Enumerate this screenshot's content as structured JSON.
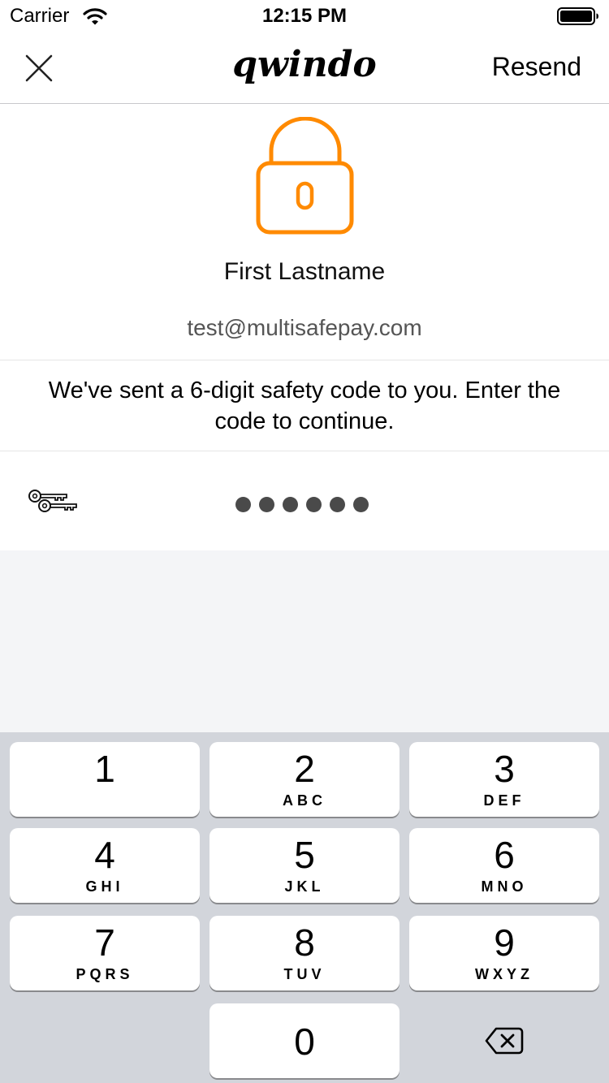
{
  "status_bar": {
    "carrier": "Carrier",
    "time": "12:15 PM"
  },
  "nav": {
    "logo": "qwindo",
    "resend_label": "Resend",
    "close_icon": "close-icon"
  },
  "profile": {
    "name": "First Lastname",
    "email": "test@multisafepay.com",
    "lock_color": "#FF8A00"
  },
  "instruction": "We've sent a 6-digit safety code to you. Enter the code to continue.",
  "code": {
    "digits_entered": 6,
    "dot_color": "#4a4a4a"
  },
  "keypad": {
    "keys": [
      {
        "digit": "1",
        "letters": ""
      },
      {
        "digit": "2",
        "letters": "ABC"
      },
      {
        "digit": "3",
        "letters": "DEF"
      },
      {
        "digit": "4",
        "letters": "GHI"
      },
      {
        "digit": "5",
        "letters": "JKL"
      },
      {
        "digit": "6",
        "letters": "MNO"
      },
      {
        "digit": "7",
        "letters": "PQRS"
      },
      {
        "digit": "8",
        "letters": "TUV"
      },
      {
        "digit": "9",
        "letters": "WXYZ"
      },
      {
        "digit": "0",
        "letters": ""
      }
    ],
    "delete_icon": "backspace-icon"
  }
}
